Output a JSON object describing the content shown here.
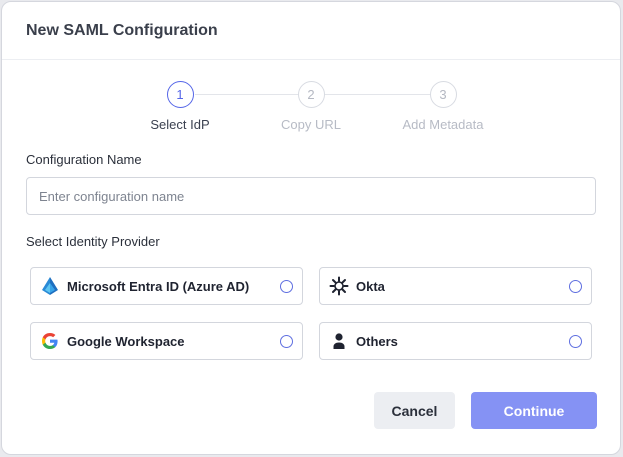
{
  "dialog": {
    "title": "New SAML Configuration"
  },
  "stepper": {
    "steps": [
      {
        "number": "1",
        "label": "Select IdP",
        "active": true
      },
      {
        "number": "2",
        "label": "Copy URL",
        "active": false
      },
      {
        "number": "3",
        "label": "Add Metadata",
        "active": false
      }
    ]
  },
  "config_name": {
    "label": "Configuration Name",
    "value": "",
    "placeholder": "Enter configuration name"
  },
  "identity_provider": {
    "label": "Select Identity Provider",
    "options": [
      {
        "name": "Microsoft Entra ID (Azure AD)",
        "icon": "azure-ad-icon",
        "selected": false
      },
      {
        "name": "Okta",
        "icon": "okta-icon",
        "selected": false
      },
      {
        "name": "Google Workspace",
        "icon": "google-icon",
        "selected": false
      },
      {
        "name": "Others",
        "icon": "user-icon",
        "selected": false
      }
    ]
  },
  "actions": {
    "cancel_label": "Cancel",
    "continue_label": "Continue"
  },
  "colors": {
    "accent": "#5566e8",
    "continue_button": "#8592f4",
    "cancel_button": "#eceef2",
    "border": "#d3d6dd"
  }
}
